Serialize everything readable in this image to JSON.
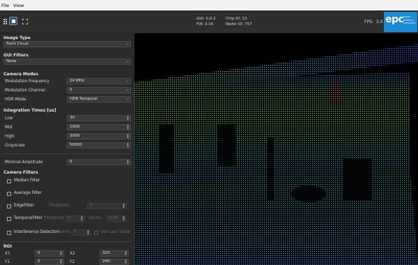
{
  "menu": [
    "File",
    "View"
  ],
  "toolbar": {
    "gui_version": "GUI: 0.0.2",
    "chip_id": "Chip ID: 13",
    "fw_version": "FW: 3.16",
    "wafer_id": "Wafer ID: 757",
    "fps_label": "FPS:",
    "fps_value": "3.0",
    "logo_text": "epc",
    "logo_sub": [
      "espros",
      "photonics",
      "corporation"
    ]
  },
  "panel": {
    "image_type": {
      "title": "Image Type",
      "value": "Point Cloud"
    },
    "gui_filters": {
      "title": "GUI Filters",
      "value": "None"
    },
    "camera_modes": {
      "title": "Camera Modes",
      "rows": [
        {
          "label": "Modulation Frequency",
          "value": "24 MHz"
        },
        {
          "label": "Modulation Channel",
          "value": "0"
        },
        {
          "label": "HDR Mode",
          "value": "HDR Temporal"
        }
      ]
    },
    "integration_times": {
      "title": "Integration Times [us]",
      "rows": [
        {
          "label": "Low",
          "value": "30"
        },
        {
          "label": "Mid",
          "value": "1000"
        },
        {
          "label": "High",
          "value": "3000"
        },
        {
          "label": "Grayscale",
          "value": "50000"
        }
      ]
    },
    "minimal_amplitude": {
      "label": "Minimal Amplitude",
      "value": "0"
    },
    "camera_filters": {
      "title": "Camera Filters",
      "median": "Median Filter",
      "average": "Average Filter",
      "edge": {
        "label": "EdgeFilter",
        "threshold_label": "Threshold",
        "threshold": "0"
      },
      "temporal": {
        "label": "TemporalFilter",
        "threshold_label": "Threshold",
        "threshold": "0",
        "factor_label": "Factor",
        "factor": "0.00"
      },
      "interference": {
        "label": "Interference Detection",
        "limit_label": "Limit",
        "limit": "0",
        "use_last_label": "Use Last Value"
      }
    },
    "roi": {
      "title": "ROI",
      "x1_label": "X1",
      "x1": "0",
      "x2_label": "X2",
      "x2": "320",
      "y1_label": "Y1",
      "y1": "0",
      "y2_label": "Y2",
      "y2": "240"
    }
  },
  "colors": {
    "accent": "#1c8bd6",
    "panel_bg": "#2b2b2b",
    "control_bg": "#3a3a3a",
    "view_bg": "#000000"
  }
}
